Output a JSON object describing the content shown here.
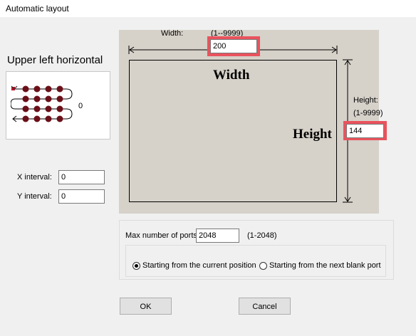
{
  "window": {
    "title": "Automatic layout"
  },
  "layout_pattern": {
    "label": "Upper left horizontal",
    "value": "0"
  },
  "intervals": {
    "x_label": "X interval:",
    "x_value": "0",
    "y_label": "Y interval:",
    "y_value": "0"
  },
  "diagram": {
    "width_label": "Width:",
    "width_range": "(1--9999)",
    "width_value": "200",
    "width_big": "Width",
    "height_label": "Height:",
    "height_range": "(1-9999)",
    "height_value": "144",
    "height_big": "Height"
  },
  "ports": {
    "label": "Max number of ports",
    "value": "2048",
    "range": "(1-2048)"
  },
  "start": {
    "option_current": "Starting from the current position",
    "option_next": "Starting from the next blank port",
    "selected": "current"
  },
  "buttons": {
    "ok": "OK",
    "cancel": "Cancel"
  },
  "colors": {
    "highlight": "#e9535d",
    "diagram_bg": "#d6d1c9",
    "dot": "#6b0f18"
  },
  "icons": {
    "dropdown": "chevron-down-icon",
    "pattern": "serpentine-layout-icon"
  }
}
